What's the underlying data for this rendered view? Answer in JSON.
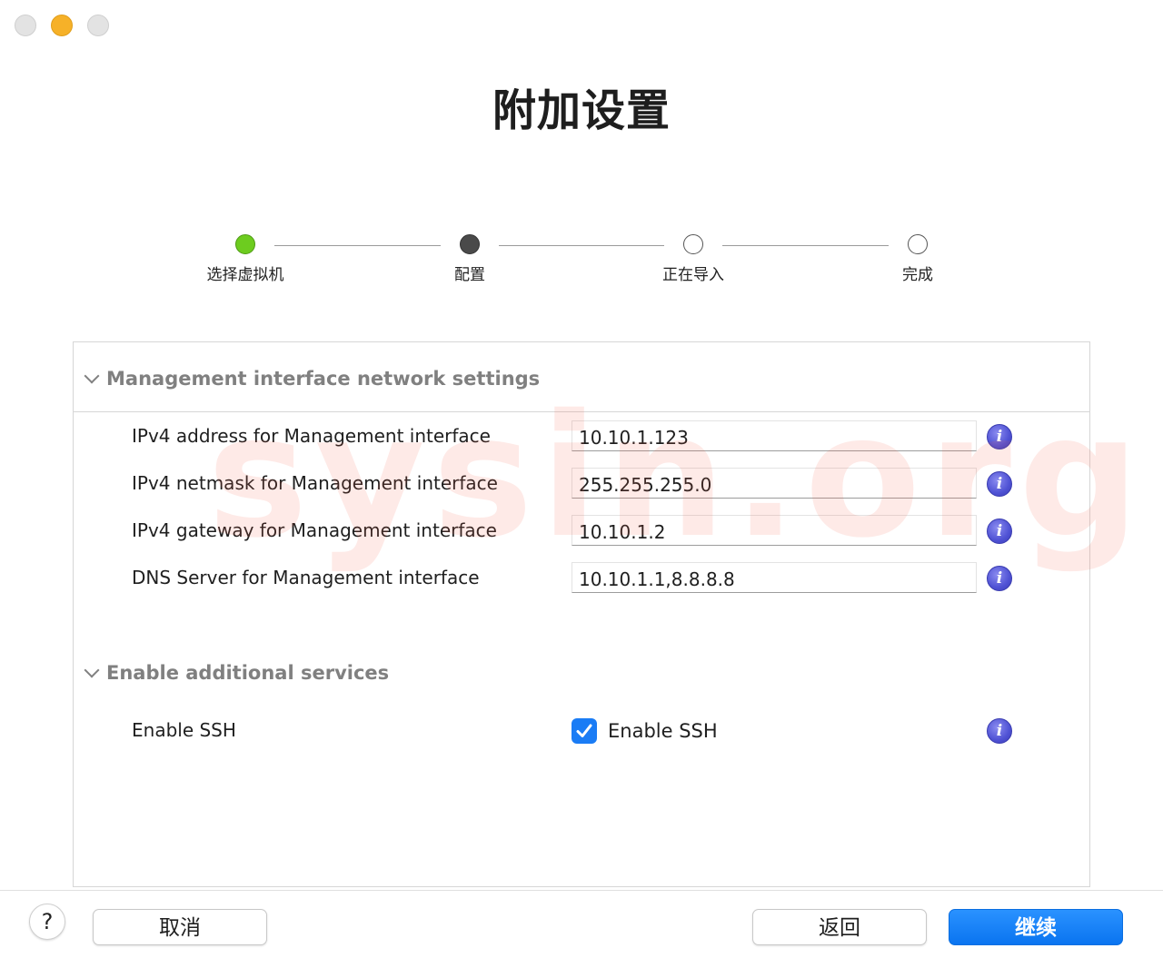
{
  "page": {
    "title": "附加设置"
  },
  "stepper": {
    "steps": [
      {
        "label": "选择虚拟机",
        "state": "done"
      },
      {
        "label": "配置",
        "state": "current"
      },
      {
        "label": "正在导入",
        "state": "todo"
      },
      {
        "label": "完成",
        "state": "todo"
      }
    ]
  },
  "sections": {
    "network": {
      "title": "Management interface network settings",
      "rows": [
        {
          "label": "IPv4 address for Management interface",
          "value": "10.10.1.123"
        },
        {
          "label": "IPv4 netmask for Management interface",
          "value": "255.255.255.0"
        },
        {
          "label": "IPv4 gateway for Management interface",
          "value": "10.10.1.2"
        },
        {
          "label": "DNS Server for Management interface",
          "value": "10.10.1.1,8.8.8.8"
        }
      ]
    },
    "services": {
      "title": "Enable additional services",
      "ssh": {
        "label": "Enable SSH",
        "checkbox_label": "Enable SSH",
        "checked": true
      }
    }
  },
  "watermark": "sysin.org",
  "footer": {
    "help": "?",
    "cancel": "取消",
    "back": "返回",
    "continue": "继续"
  },
  "colors": {
    "accent": "#1a7cf5",
    "step_done": "#6dcc1f",
    "info_icon": "#4f52d4"
  },
  "icons": {
    "info": "info-icon",
    "chevron": "chevron-down-icon",
    "check": "checkmark-icon"
  }
}
